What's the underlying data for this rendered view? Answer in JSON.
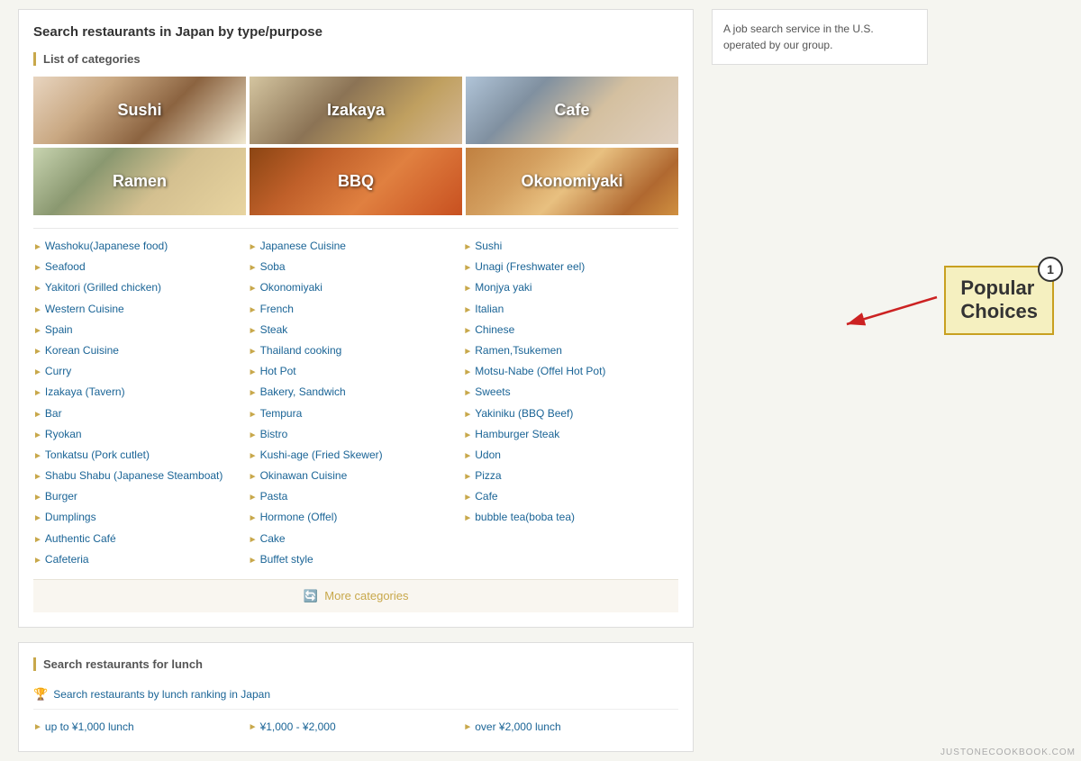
{
  "sidebar": {
    "description": "A job search service in the U.S. operated by our group."
  },
  "main": {
    "search_title": "Search restaurants in Japan by type/purpose",
    "categories_label": "List of categories",
    "image_items": [
      {
        "label": "Sushi",
        "bg_class": "bg-sushi"
      },
      {
        "label": "Izakaya",
        "bg_class": "bg-izakaya"
      },
      {
        "label": "Cafe",
        "bg_class": "bg-cafe"
      },
      {
        "label": "Ramen",
        "bg_class": "bg-ramen"
      },
      {
        "label": "BBQ",
        "bg_class": "bg-bbq"
      },
      {
        "label": "Okonomiyaki",
        "bg_class": "bg-okonomiyaki"
      }
    ],
    "links_col1": [
      "Washoku(Japanese food)",
      "Seafood",
      "Yakitori (Grilled chicken)",
      "Western Cuisine",
      "Spain",
      "Korean Cuisine",
      "Curry",
      "Izakaya (Tavern)",
      "Bar",
      "Ryokan",
      "Tonkatsu (Pork cutlet)",
      "Shabu Shabu (Japanese Steamboat)",
      "Burger",
      "Dumplings",
      "Authentic Café",
      "Cafeteria"
    ],
    "links_col2": [
      "Japanese Cuisine",
      "Soba",
      "Okonomiyaki",
      "French",
      "Steak",
      "Thailand cooking",
      "Hot Pot",
      "Bakery, Sandwich",
      "Tempura",
      "Bistro",
      "Kushi-age (Fried Skewer)",
      "Okinawan Cuisine",
      "Pasta",
      "Hormone (Offel)",
      "Cake",
      "Buffet style"
    ],
    "links_col3": [
      "Sushi",
      "Unagi (Freshwater eel)",
      "Monjya yaki",
      "Italian",
      "Chinese",
      "Ramen,Tsukemen",
      "Motsu-Nabe (Offel Hot Pot)",
      "Sweets",
      "Yakiniku (BBQ Beef)",
      "Hamburger Steak",
      "Udon",
      "Pizza",
      "Cafe",
      "bubble tea(boba tea)"
    ],
    "more_categories": "More categories",
    "lunch_title": "Search restaurants for lunch",
    "lunch_ranking_label": "Search restaurants by lunch ranking in Japan",
    "price_ranges": [
      "up to ¥1,000 lunch",
      "¥1,000 - ¥2,000",
      "over ¥2,000 lunch"
    ]
  },
  "annotation": {
    "popular_choices": "Popular\nChoices",
    "badge_number": "1"
  },
  "watermark": "JUSTONECOOKBOOK.COM"
}
